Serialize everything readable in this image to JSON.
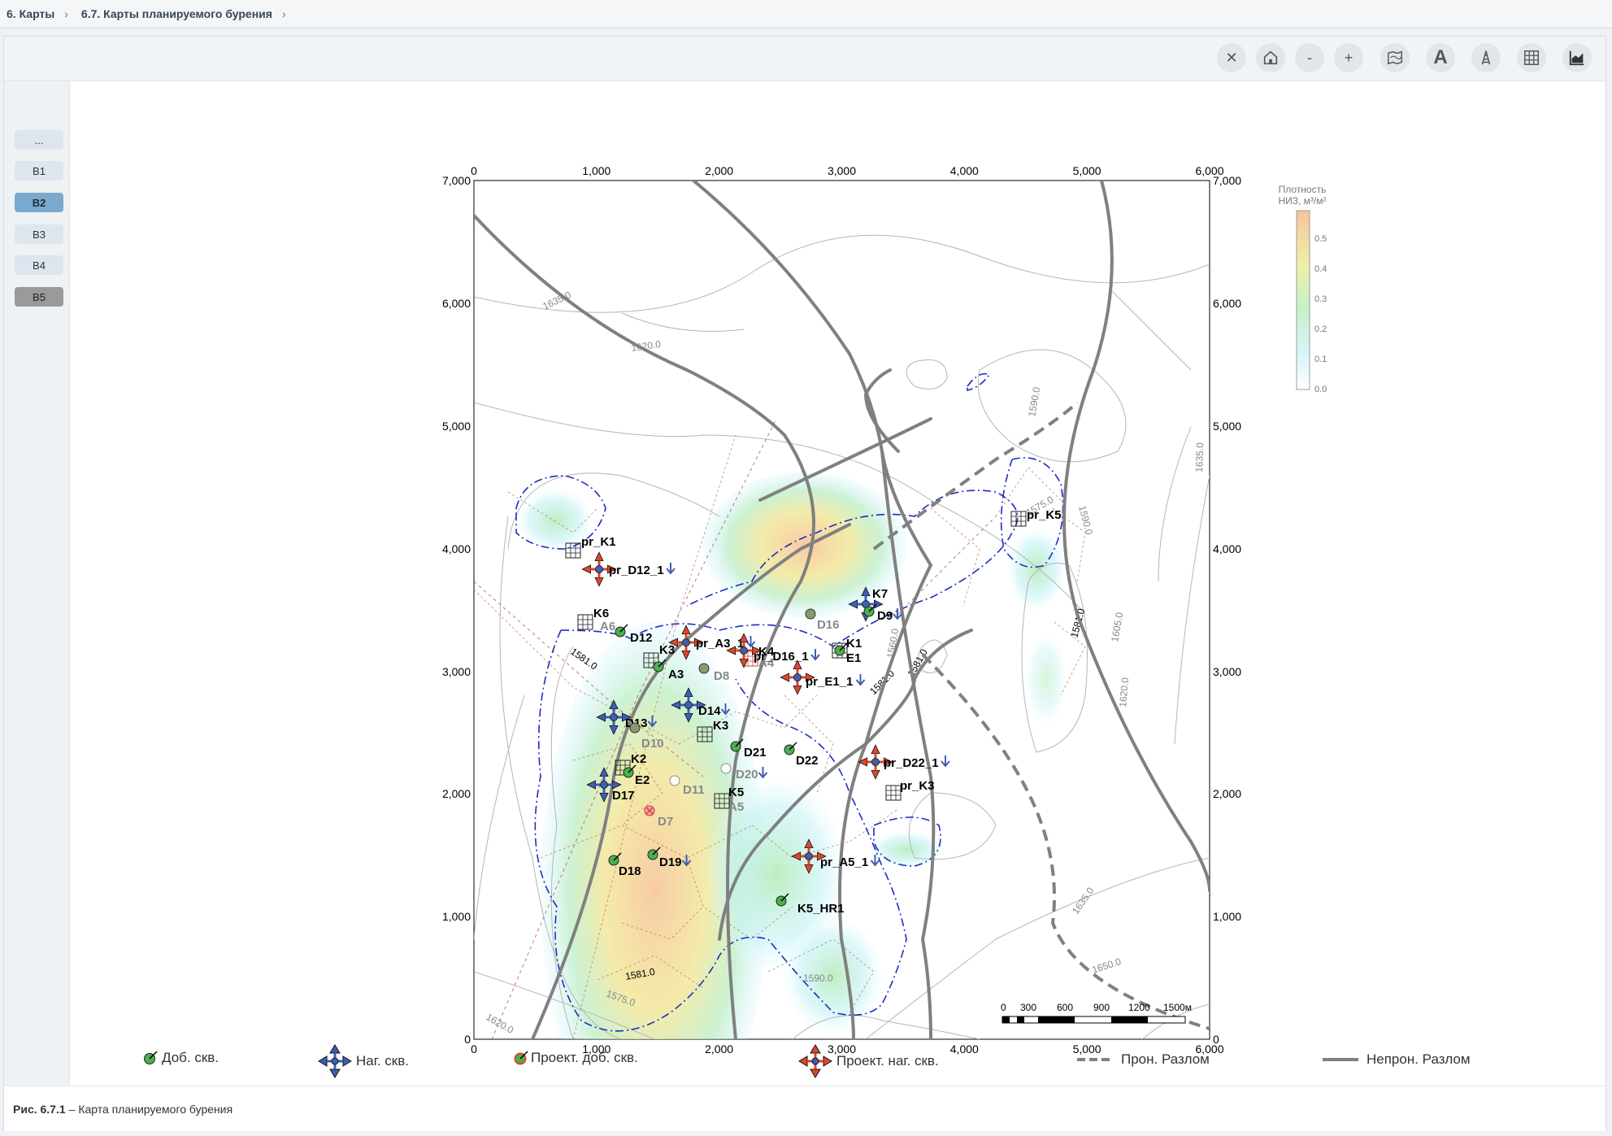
{
  "breadcrumbs": [
    "6. Карты",
    "6.7. Карты планируемого бурения"
  ],
  "toolbar": {
    "buttons": [
      {
        "name": "close-button",
        "icon": "close-icon",
        "label": "✕"
      },
      {
        "name": "home-button",
        "icon": "home-icon",
        "label": ""
      },
      {
        "name": "zoom-out-button",
        "icon": "minus-icon",
        "label": "-"
      },
      {
        "name": "zoom-in-button",
        "icon": "plus-icon",
        "label": "+"
      },
      {
        "name": "map-layer-button",
        "icon": "map-icon",
        "label": ""
      },
      {
        "name": "labels-button",
        "icon": "letter-a-icon",
        "label": "A"
      },
      {
        "name": "wells-button",
        "icon": "derrick-icon",
        "label": ""
      },
      {
        "name": "grid-button",
        "icon": "grid-icon",
        "label": ""
      },
      {
        "name": "chart-button",
        "icon": "area-chart-icon",
        "label": ""
      }
    ]
  },
  "sidebar": {
    "items": [
      {
        "label": "...",
        "state": "normal"
      },
      {
        "label": "B1",
        "state": "normal"
      },
      {
        "label": "B2",
        "state": "active"
      },
      {
        "label": "B3",
        "state": "normal"
      },
      {
        "label": "B4",
        "state": "normal"
      },
      {
        "label": "B5",
        "state": "dark"
      }
    ]
  },
  "map": {
    "x_ticks": [
      "0",
      "1,000",
      "2,000",
      "3,000",
      "4,000",
      "5,000",
      "6,000"
    ],
    "y_ticks": [
      "0",
      "1,000",
      "2,000",
      "3,000",
      "4,000",
      "5,000",
      "6,000",
      "7,000"
    ],
    "colorbar": {
      "title_line1": "Плотность",
      "title_line2": "НИЗ, м³/м²",
      "ticks": [
        "0.0",
        "0.1",
        "0.2",
        "0.3",
        "0.4",
        "0.5"
      ]
    },
    "contour_labels": [
      "1635.0",
      "1620.0",
      "1590.0",
      "1635.0",
      "1590.0",
      "1581.0",
      "1605.0",
      "1620.0",
      "1581.0",
      "1575.0",
      "1560.0",
      "1581.0",
      "1581.0",
      "1575.0",
      "1581.0",
      "1590.0",
      "1620.0",
      "1635.0",
      "1650.0"
    ],
    "scale_bar": {
      "labels": [
        "0",
        "300",
        "600",
        "900",
        "1200",
        "1500м"
      ]
    },
    "wells": [
      {
        "label": "pr_K1",
        "kind": "proj"
      },
      {
        "label": "pr_D12_1",
        "kind": "proj"
      },
      {
        "label": "K6",
        "kind": "std"
      },
      {
        "label": "A6",
        "kind": "grey"
      },
      {
        "label": "D12",
        "kind": "std"
      },
      {
        "label": "K3",
        "kind": "std"
      },
      {
        "label": "A3",
        "kind": "std"
      },
      {
        "label": "pr_A3_1",
        "kind": "proj"
      },
      {
        "label": "D8",
        "kind": "grey"
      },
      {
        "label": "K4",
        "kind": "std"
      },
      {
        "label": "A4",
        "kind": "grey"
      },
      {
        "label": "D14",
        "kind": "std"
      },
      {
        "label": "D13",
        "kind": "std"
      },
      {
        "label": "K3",
        "kind": "std"
      },
      {
        "label": "D10",
        "kind": "grey"
      },
      {
        "label": "D21",
        "kind": "std"
      },
      {
        "label": "K2",
        "kind": "std"
      },
      {
        "label": "E2",
        "kind": "std"
      },
      {
        "label": "D22",
        "kind": "std"
      },
      {
        "label": "D20",
        "kind": "grey"
      },
      {
        "label": "D17",
        "kind": "std"
      },
      {
        "label": "D11",
        "kind": "grey"
      },
      {
        "label": "K5",
        "kind": "std"
      },
      {
        "label": "A5",
        "kind": "grey"
      },
      {
        "label": "D7",
        "kind": "grey"
      },
      {
        "label": "D18",
        "kind": "std"
      },
      {
        "label": "D19",
        "kind": "std"
      },
      {
        "label": "pr_A5_1",
        "kind": "proj"
      },
      {
        "label": "K5_HR1",
        "kind": "std"
      },
      {
        "label": "pr_D22_1",
        "kind": "proj"
      },
      {
        "label": "pr_K3",
        "kind": "proj"
      },
      {
        "label": "K7",
        "kind": "std"
      },
      {
        "label": "D9",
        "kind": "std"
      },
      {
        "label": "D16",
        "kind": "grey"
      },
      {
        "label": "K1",
        "kind": "std"
      },
      {
        "label": "E1",
        "kind": "std"
      },
      {
        "label": "pr_D16_1",
        "kind": "proj"
      },
      {
        "label": "pr_E1_1",
        "kind": "proj"
      },
      {
        "label": "pr_K5",
        "kind": "proj"
      }
    ]
  },
  "legend": {
    "items": [
      "Доб. скв.",
      "Наг. скв.",
      "Проект. доб. скв.",
      "Проект. наг. скв.",
      "Прон. Разлом",
      "Непрон. Разлом"
    ]
  },
  "caption": {
    "figure": "Рис. 6.7.1",
    "text": "– Карта планируемого бурения"
  },
  "colors": {
    "accent": "#7aa9cf",
    "fault": "#808080",
    "oil_contour": "#1a2fbf",
    "producer": "#4caf50",
    "injector": "#3e5fb0",
    "projected": "#d9472e"
  }
}
